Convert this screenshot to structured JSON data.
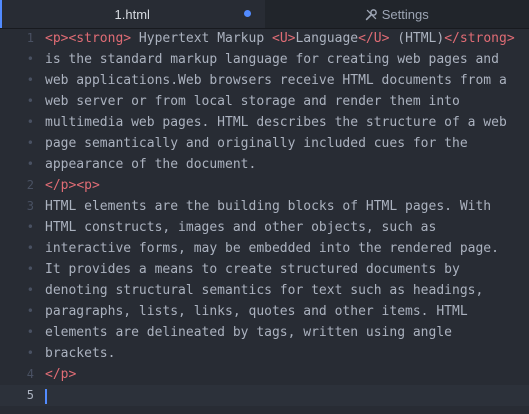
{
  "tabs": [
    {
      "label": "1.html",
      "modified": true
    },
    {
      "label": "Settings",
      "icon": "settings-icon"
    }
  ],
  "gutter": {
    "line_numbers": [
      "1",
      "2",
      "3",
      "4",
      "5"
    ],
    "wrap_marker": "•"
  },
  "editor": {
    "lines": [
      [
        {
          "t": "<p>",
          "c": "tag"
        },
        {
          "t": "<strong>",
          "c": "tag"
        },
        {
          "t": " Hypertext Markup "
        },
        {
          "t": "<U>",
          "c": "tag"
        },
        {
          "t": "Language"
        },
        {
          "t": "</U>",
          "c": "tag"
        },
        {
          "t": " (HTML)"
        },
        {
          "t": "</strong>",
          "c": "tag"
        }
      ],
      [
        {
          "t": "is the standard markup language for creating web pages and"
        }
      ],
      [
        {
          "t": "web applications.Web browsers receive HTML documents from a"
        }
      ],
      [
        {
          "t": "web server or from local storage and render them into"
        }
      ],
      [
        {
          "t": "multimedia web pages. HTML describes the structure of a web"
        }
      ],
      [
        {
          "t": "page semantically and originally included cues for the"
        }
      ],
      [
        {
          "t": "appearance of the document."
        }
      ],
      [
        {
          "t": "</p>",
          "c": "tag"
        },
        {
          "t": "<p>",
          "c": "tag"
        }
      ],
      [
        {
          "t": "HTML elements are the building blocks of HTML pages. With"
        }
      ],
      [
        {
          "t": "HTML constructs, images and other objects, such as"
        }
      ],
      [
        {
          "t": "interactive forms, may be embedded into the rendered page."
        }
      ],
      [
        {
          "t": "It provides a means to create structured documents by"
        }
      ],
      [
        {
          "t": "denoting structural semantics for text such as headings,"
        }
      ],
      [
        {
          "t": "paragraphs, lists, links, quotes and other items. HTML"
        }
      ],
      [
        {
          "t": "elements are delineated by tags, written using angle"
        }
      ],
      [
        {
          "t": "brackets."
        }
      ],
      [
        {
          "t": "</p>",
          "c": "tag"
        }
      ],
      []
    ],
    "gutter_map": [
      "1",
      "•",
      "•",
      "•",
      "•",
      "•",
      "•",
      "2",
      "3",
      "•",
      "•",
      "•",
      "•",
      "•",
      "•",
      "•",
      "4",
      "5"
    ]
  },
  "colors": {
    "tag": "#e06c75",
    "text": "#abb2bf",
    "accent": "#528bff",
    "background": "#282c34"
  }
}
